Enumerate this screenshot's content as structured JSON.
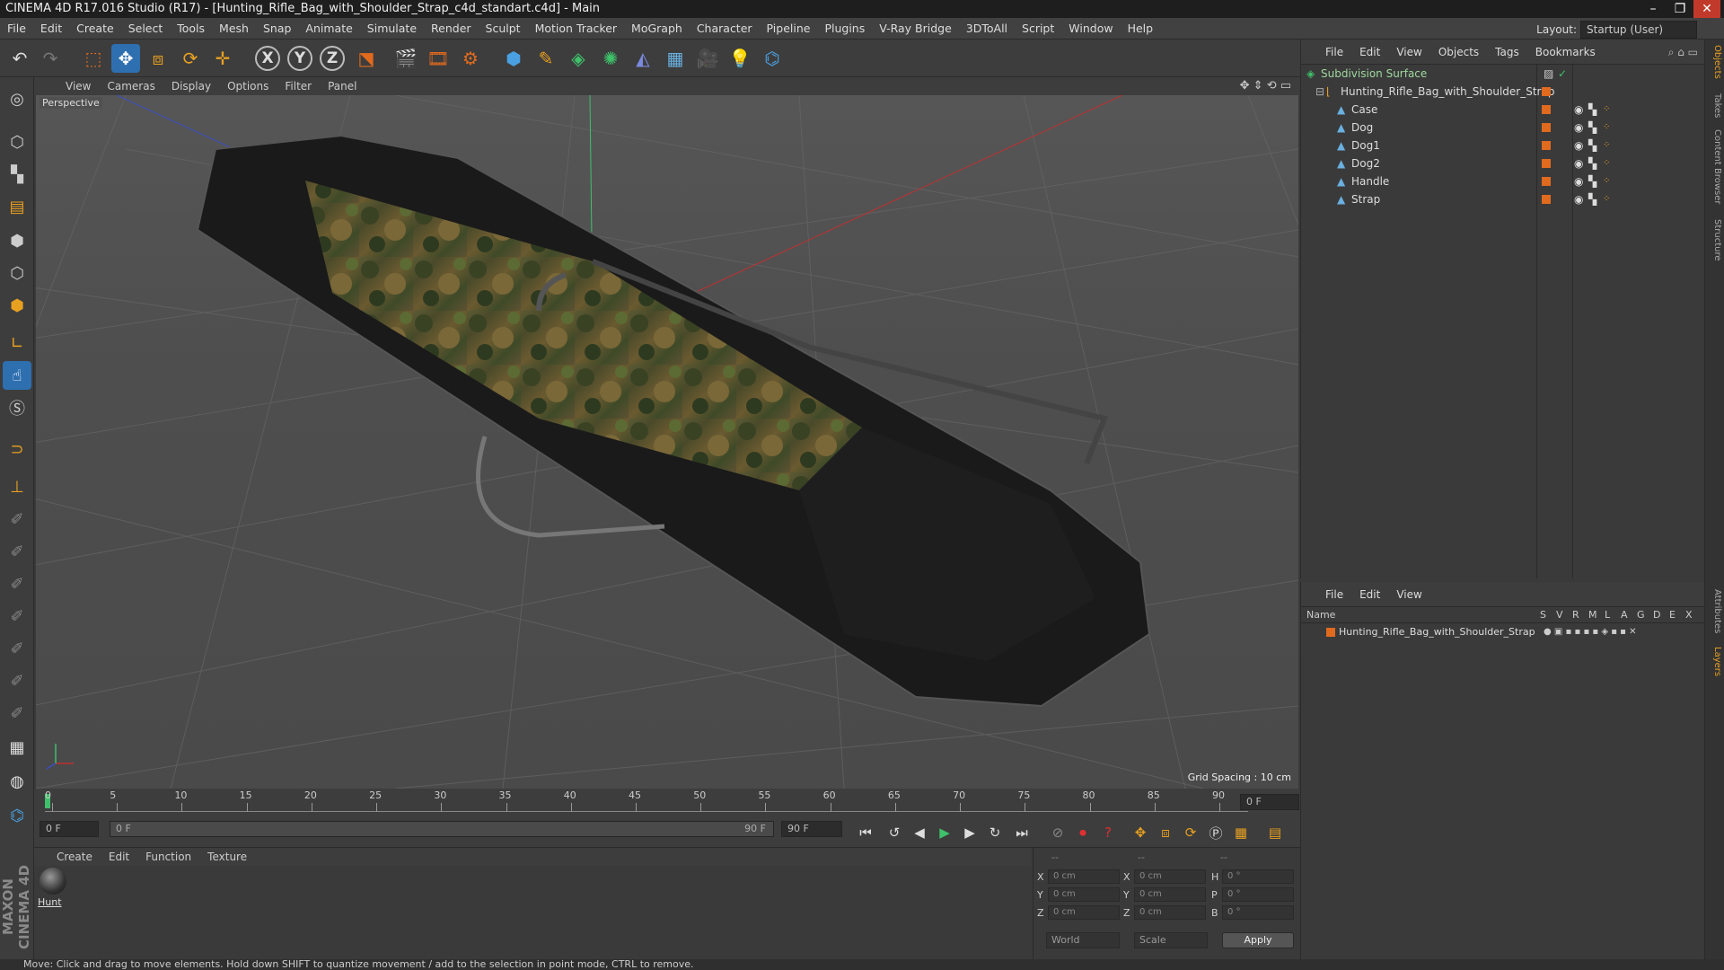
{
  "window_title": "CINEMA 4D R17.016 Studio (R17) - [Hunting_Rifle_Bag_with_Shoulder_Strap_c4d_standart.c4d] - Main",
  "window_controls": {
    "minimize": "–",
    "restore": "❐",
    "close": "✕"
  },
  "menu": [
    "File",
    "Edit",
    "Create",
    "Select",
    "Tools",
    "Mesh",
    "Snap",
    "Animate",
    "Simulate",
    "Render",
    "Sculpt",
    "Motion Tracker",
    "MoGraph",
    "Character",
    "Pipeline",
    "Plugins",
    "V-Ray Bridge",
    "3DToAll",
    "Script",
    "Window",
    "Help"
  ],
  "layout": {
    "label": "Layout:",
    "value": "Startup (User)"
  },
  "toolbar": {
    "axis_x": "X",
    "axis_y": "Y",
    "axis_z": "Z"
  },
  "viewport": {
    "menu": [
      "View",
      "Cameras",
      "Display",
      "Options",
      "Filter",
      "Panel"
    ],
    "label": "Perspective",
    "grid_spacing": "Grid Spacing : 10 cm"
  },
  "timeline": {
    "ticks": [
      "0",
      "5",
      "10",
      "15",
      "20",
      "25",
      "30",
      "35",
      "40",
      "45",
      "50",
      "55",
      "60",
      "65",
      "70",
      "75",
      "80",
      "85",
      "90"
    ],
    "current_frame": "0 F",
    "start_field": "0 F",
    "range_start": "0 F",
    "range_end": "90 F",
    "end_field": "90 F"
  },
  "material": {
    "menu": [
      "Create",
      "Edit",
      "Function",
      "Texture"
    ],
    "items": [
      {
        "name": "Hunt"
      }
    ]
  },
  "coords": {
    "headers": [
      "--",
      "--",
      "--"
    ],
    "rows": [
      {
        "a": "X",
        "av": "0 cm",
        "b": "X",
        "bv": "0 cm",
        "c": "H",
        "cv": "0 °"
      },
      {
        "a": "Y",
        "av": "0 cm",
        "b": "Y",
        "bv": "0 cm",
        "c": "P",
        "cv": "0 °"
      },
      {
        "a": "Z",
        "av": "0 cm",
        "b": "Z",
        "bv": "0 cm",
        "c": "B",
        "cv": "0 °"
      }
    ],
    "mode1": "World",
    "mode2": "Scale",
    "apply": "Apply"
  },
  "objects": {
    "menu": [
      "File",
      "Edit",
      "View",
      "Objects",
      "Tags",
      "Bookmarks"
    ],
    "root": "Subdivision Surface",
    "group": "Hunting_Rifle_Bag_with_Shoulder_Strap",
    "children": [
      "Case",
      "Dog",
      "Dog1",
      "Dog2",
      "Handle",
      "Strap"
    ]
  },
  "layers": {
    "menu": [
      "File",
      "Edit",
      "View"
    ],
    "name_header": "Name",
    "columns": [
      "S",
      "V",
      "R",
      "M",
      "L",
      "A",
      "G",
      "D",
      "E",
      "X"
    ],
    "rows": [
      "Hunting_Rifle_Bag_with_Shoulder_Strap"
    ]
  },
  "side_tabs": [
    "Objects",
    "Takes",
    "Content Browser",
    "Structure",
    "Attributes",
    "Layers"
  ],
  "status": "Move: Click and drag to move elements. Hold down SHIFT to quantize movement / add to the selection in point mode, CTRL to remove.",
  "brand": "MAXON CINEMA 4D",
  "colors": {
    "accent": "#e06a1e",
    "active_blue": "#2e6fb0",
    "bg": "#3a3a3a"
  }
}
